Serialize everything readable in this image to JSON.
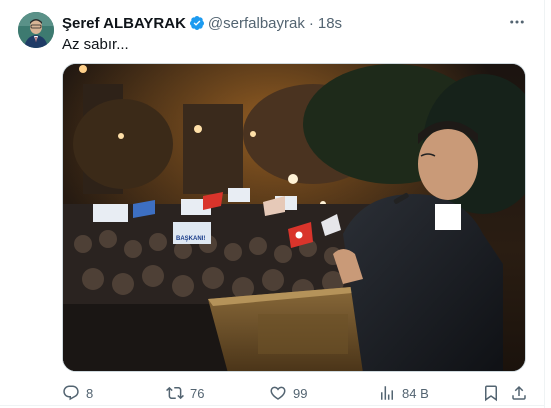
{
  "author": {
    "name": "Şeref ALBAYRAK",
    "handle": "@serfalbayrak",
    "separator": "·",
    "time": "18s",
    "verified_color": "#1d9bf0"
  },
  "tweet": {
    "text": "Az sabır..."
  },
  "media": {
    "alt_signs": [
      "BAŞKANI!"
    ]
  },
  "actions": {
    "replies": "8",
    "reposts": "76",
    "likes": "99",
    "views": "84 B"
  },
  "icons": [
    "more-icon",
    "verified-badge-icon",
    "reply-icon",
    "repost-icon",
    "like-icon",
    "views-icon",
    "bookmark-icon",
    "share-icon"
  ]
}
